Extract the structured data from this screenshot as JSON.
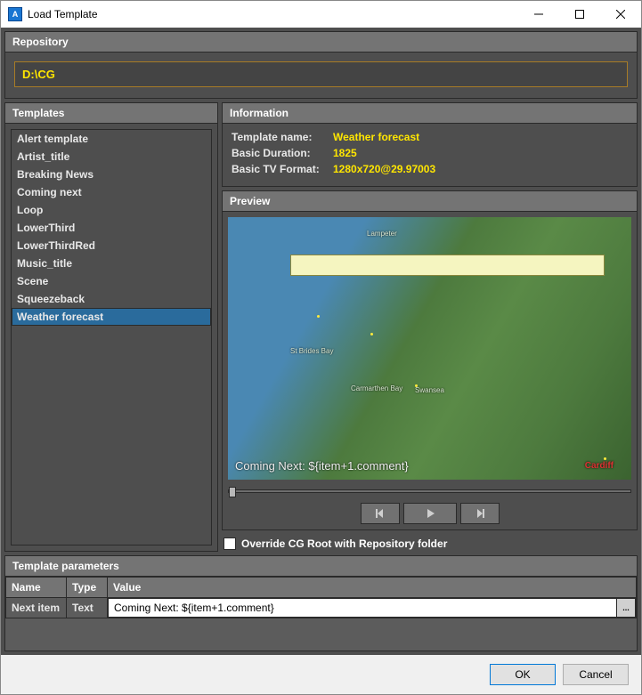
{
  "window": {
    "title": "Load Template"
  },
  "repository": {
    "header": "Repository",
    "path": "D:\\CG"
  },
  "templates": {
    "header": "Templates",
    "items": [
      "Alert template",
      "Artist_title",
      "Breaking News",
      "Coming next",
      "Loop",
      "LowerThird",
      "LowerThirdRed",
      "Music_title",
      "Scene",
      "Squeezeback",
      "Weather forecast"
    ],
    "selected_index": 10
  },
  "information": {
    "header": "Information",
    "rows": [
      {
        "label": "Template name:",
        "value": "Weather forecast"
      },
      {
        "label": "Basic Duration:",
        "value": "1825"
      },
      {
        "label": "Basic TV Format:",
        "value": "1280x720@29.97003"
      }
    ]
  },
  "preview": {
    "header": "Preview",
    "overlay_text": "Coming Next: ${item+1.comment}"
  },
  "override": {
    "checked": false,
    "label": "Override CG Root with Repository folder"
  },
  "parameters": {
    "header": "Template parameters",
    "columns": [
      "Name",
      "Type",
      "Value"
    ],
    "rows": [
      {
        "name": "Next item",
        "type": "Text",
        "value": "Coming Next: ${item+1.comment}"
      }
    ],
    "browse_btn": "..."
  },
  "buttons": {
    "ok": "OK",
    "cancel": "Cancel"
  }
}
